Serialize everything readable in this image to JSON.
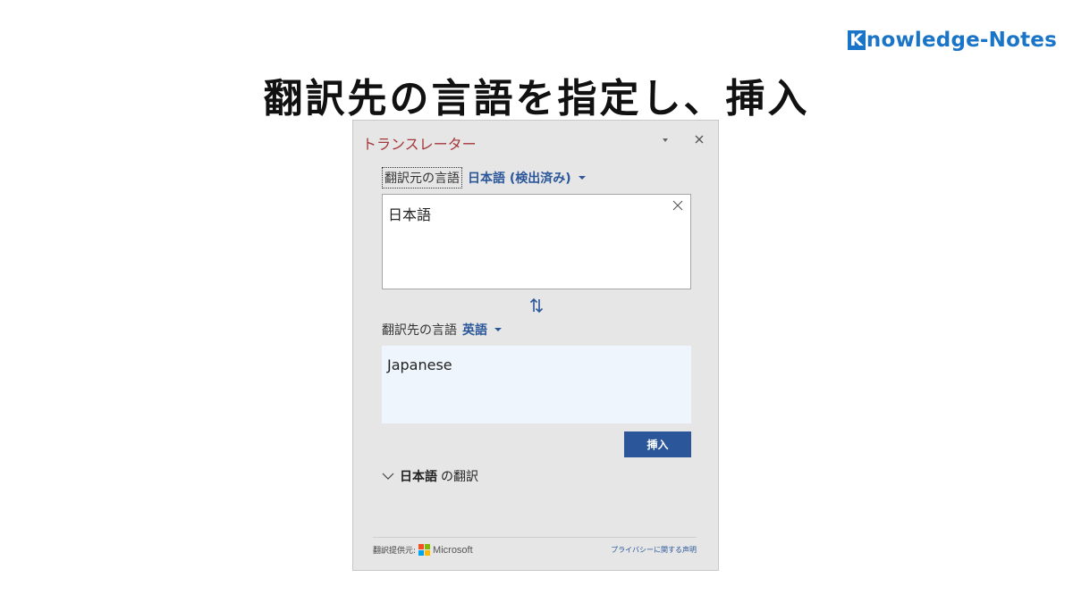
{
  "brand": {
    "k_letter": "K",
    "rest": "nowledge-Notes",
    "color": "#1a75c9"
  },
  "headline": "翻訳先の言語を指定し、挿入",
  "pane": {
    "title": "トランスレーター",
    "title_color": "#a4373a",
    "menu_icon": "chevron-down-icon",
    "close_icon": "close-icon",
    "source": {
      "label": "翻訳元の言語",
      "language": "日本語 (検出済み)",
      "text": "日本語",
      "clear_icon": "close-icon"
    },
    "swap_icon": "swap-arrows-icon",
    "target": {
      "label": "翻訳先の言語",
      "language": "英語",
      "text": "Japanese"
    },
    "insert_label": "挿入",
    "expander": {
      "bold": "日本語",
      "rest": "の翻訳"
    },
    "footer": {
      "provider_label": "翻訳提供元:",
      "provider_name": "Microsoft",
      "privacy_link": "プライバシーに関する声明"
    },
    "accent_color": "#2b579a"
  }
}
